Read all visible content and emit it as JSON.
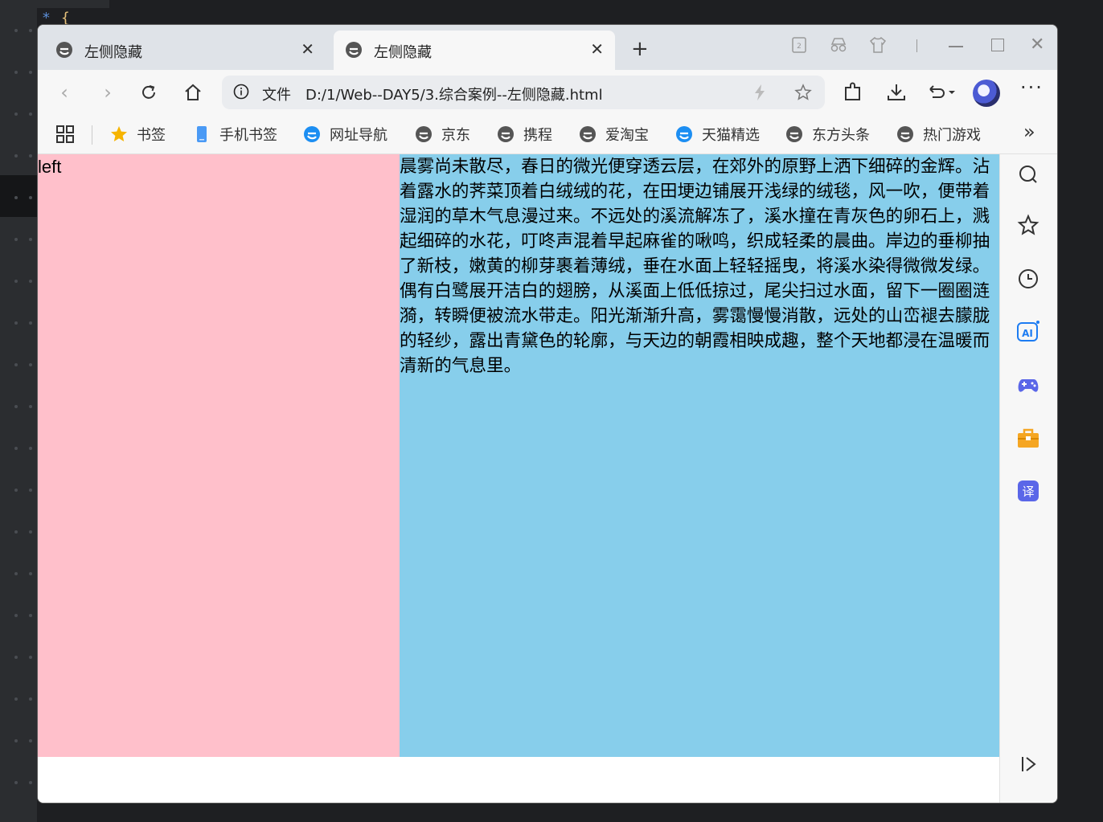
{
  "tabs": [
    {
      "title": "左侧隐藏",
      "active": false
    },
    {
      "title": "左侧隐藏",
      "active": true
    }
  ],
  "new_tab_label": "+",
  "address_bar": {
    "security_label": "文件",
    "url": "D:/1/Web--DAY5/3.综合案例--左侧隐藏.html"
  },
  "toolbar": {
    "more_label": "···"
  },
  "bookmarks": {
    "items": [
      {
        "label": "书签",
        "icon": "star-icon"
      },
      {
        "label": "手机书签",
        "icon": "phone-icon"
      },
      {
        "label": "网址导航",
        "icon": "browser-e-icon"
      },
      {
        "label": "京东",
        "icon": "browser-e-icon"
      },
      {
        "label": "携程",
        "icon": "browser-e-icon"
      },
      {
        "label": "爱淘宝",
        "icon": "browser-e-icon"
      },
      {
        "label": "天猫精选",
        "icon": "browser-e-icon"
      },
      {
        "label": "东方头条",
        "icon": "browser-e-icon"
      },
      {
        "label": "热门游戏",
        "icon": "browser-e-icon"
      }
    ],
    "overflow_label": "»"
  },
  "page": {
    "left_text": "left",
    "right_text": "晨雾尚未散尽，春日的微光便穿透云层，在郊外的原野上洒下细碎的金辉。沾着露水的荠菜顶着白绒绒的花，在田埂边铺展开浅绿的绒毯，风一吹，便带着湿润的草木气息漫过来。不远处的溪流解冻了，溪水撞在青灰色的卵石上，溅起细碎的水花，叮咚声混着早起麻雀的啾鸣，织成轻柔的晨曲。岸边的垂柳抽了新枝，嫩黄的柳芽裹着薄绒，垂在水面上轻轻摇曳，将溪水染得微微发绿。偶有白鹭展开洁白的翅膀，从溪面上低低掠过，尾尖扫过水面，留下一圈圈涟漪，转瞬便被流水带走。阳光渐渐升高，雾霭慢慢消散，远处的山峦褪去朦胧的轻纱，露出青黛色的轮廓，与天边的朝霞相映成趣，整个天地都浸在温暖而清新的气息里。"
  },
  "colors": {
    "left_bg": "#ffc0cb",
    "right_bg": "#87ceeb"
  }
}
